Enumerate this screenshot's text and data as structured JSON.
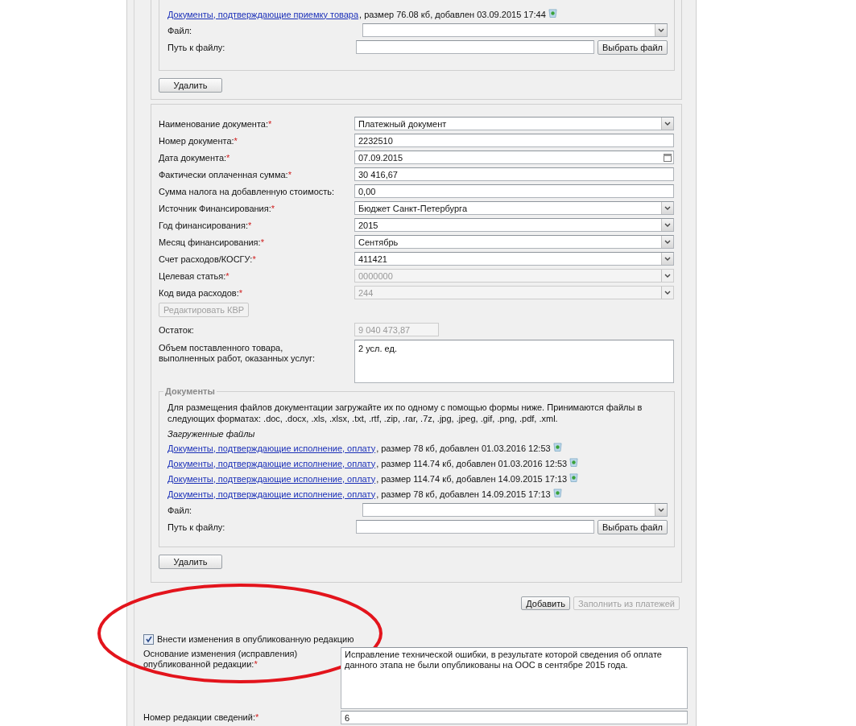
{
  "top_section": {
    "files": [
      {
        "link": "Документы, подтверждающие приемку товара",
        "info": ", размер 76.08 кб, добавлен 03.09.2015 17:44"
      }
    ],
    "file_label": "Файл:",
    "path_label": "Путь к файлу:",
    "browse_button": "Выбрать файл",
    "delete_button": "Удалить"
  },
  "document_section": {
    "fields": [
      {
        "label": "Наименование документа:",
        "required_mark": "*",
        "kind": "select",
        "value": "Платежный документ",
        "disabled": false
      },
      {
        "label": "Номер документа:",
        "required_mark": "*",
        "kind": "text",
        "value": "2232510",
        "disabled": false
      },
      {
        "label": "Дата документа:",
        "required_mark": "*",
        "kind": "date",
        "value": "07.09.2015",
        "disabled": false
      },
      {
        "label": "Фактически оплаченная сумма:",
        "required_mark": "*",
        "kind": "text",
        "value": "30 416,67",
        "disabled": false
      },
      {
        "label": "Сумма налога на добавленную стоимость:",
        "kind": "text",
        "value": "0,00",
        "disabled": false
      },
      {
        "label": "Источник Финансирования:",
        "required_mark": "*",
        "kind": "select",
        "value": "Бюджет Санкт-Петербурга",
        "disabled": false
      },
      {
        "label": "Год финансирования:",
        "required_mark": "*",
        "kind": "select",
        "value": "2015",
        "disabled": false
      },
      {
        "label": "Месяц финансирования:",
        "required_mark": "*",
        "kind": "select",
        "value": "Сентябрь",
        "disabled": false
      },
      {
        "label": "Счет расходов/КОСГУ:",
        "required_mark": "*",
        "kind": "select",
        "value": "411421",
        "disabled": false
      },
      {
        "label": "Целевая статья:",
        "required_mark": "*",
        "kind": "select",
        "value": "0000000",
        "disabled": true
      },
      {
        "label": "Код вида расходов:",
        "required_mark": "*",
        "kind": "select",
        "value": "244",
        "disabled": true
      }
    ],
    "edit_kvr_button": {
      "label": "Редактировать КВР",
      "disabled": true
    },
    "remainder": {
      "label": "Остаток:",
      "value": "9 040 473,87",
      "disabled": true
    },
    "volume": {
      "label": "Объем поставленного товара, выполненных работ, оказанных услуг:",
      "value": "2 усл. ед."
    },
    "documents": {
      "legend": "Документы",
      "note": "Для размещения файлов документации загружайте их по одному с помощью формы ниже. Принимаются файлы в следующих форматах: .doc, .docx, .xls, .xlsx, .txt, .rtf, .zip, .rar, .7z, .jpg, .jpeg, .gif, .png, .pdf, .xml.",
      "uploaded_title": "Загруженные файлы",
      "files": [
        {
          "link": "Документы, подтверждающие исполнение, оплату",
          "info": ", размер 78 кб, добавлен 01.03.2016 12:53"
        },
        {
          "link": "Документы, подтверждающие исполнение, оплату",
          "info": ", размер 114.74 кб, добавлен 01.03.2016 12:53"
        },
        {
          "link": "Документы, подтверждающие исполнение, оплату",
          "info": ", размер 114.74 кб, добавлен 14.09.2015 17:13"
        },
        {
          "link": "Документы, подтверждающие исполнение, оплату",
          "info": ", размер 78 кб, добавлен 14.09.2015 17:13"
        }
      ],
      "file_label": "Файл:",
      "path_label": "Путь к файлу:",
      "browse_button": "Выбрать файл"
    },
    "delete_button": "Удалить"
  },
  "actions": [
    {
      "label": "Добавить",
      "disabled": false
    },
    {
      "label": "Заполнить из платежей",
      "disabled": true
    }
  ],
  "publish_change": {
    "label": "Внести изменения в опубликованную редакцию",
    "checked": true
  },
  "reason": {
    "label": "Основание изменения (исправления) опубликованной редакции:",
    "required_mark": "*",
    "value": "Исправление технической ошибки, в результате которой сведения об оплате данного этапа не были опубликованы на ООС в сентябре 2015 года."
  },
  "revision": {
    "label": "Номер редакции сведений:",
    "required_mark": "*",
    "value": "6"
  }
}
